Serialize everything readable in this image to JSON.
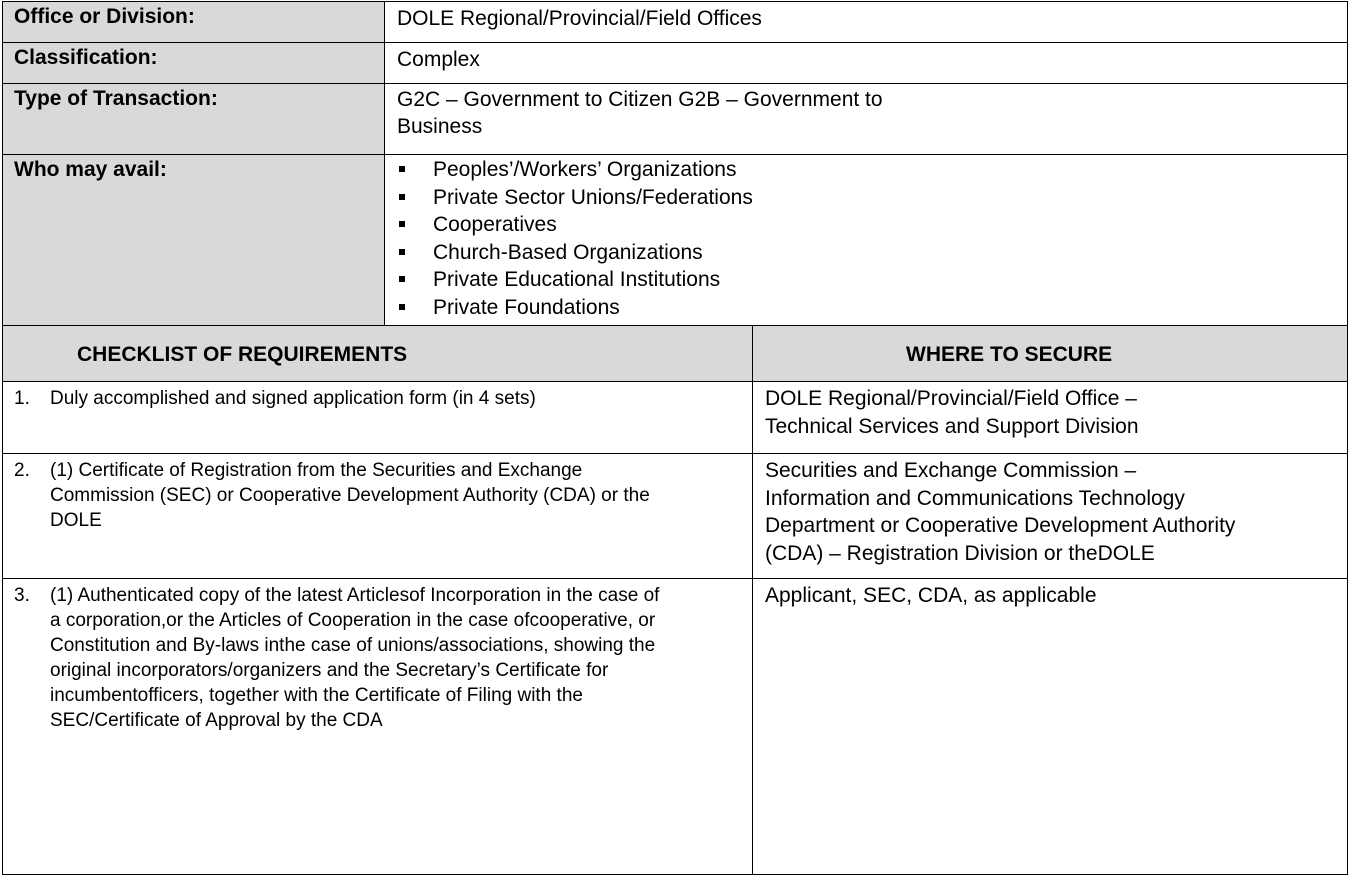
{
  "info": {
    "office_label": "Office or Division:",
    "office_value": "DOLE Regional/Provincial/Field Offices",
    "classification_label": "Classification:",
    "classification_value": "Complex",
    "transaction_label": "Type of Transaction:",
    "transaction_line1": "G2C – Government to Citizen G2B – Government to",
    "transaction_line2": "Business",
    "avail_label": "Who may avail:",
    "avail_items": [
      "Peoples’/Workers’ Organizations",
      "Private Sector Unions/Federations",
      "Cooperatives",
      "Church-Based Organizations",
      "Private Educational Institutions",
      "Private Foundations"
    ]
  },
  "checklist": {
    "header_requirements": "CHECKLIST OF REQUIREMENTS",
    "header_where": "WHERE TO SECURE",
    "rows": [
      {
        "number": "1.",
        "requirement_lines": [
          "Duly accomplished and signed application form (in 4 sets)"
        ],
        "where_lines": [
          "DOLE Regional/Provincial/Field Office –",
          "Technical Services and Support Division"
        ]
      },
      {
        "number": "2.",
        "requirement_lines": [
          "(1) Certificate of Registration from the Securities and Exchange",
          "Commission (SEC) or Cooperative Development Authority (CDA) or the",
          "DOLE"
        ],
        "where_lines": [
          "Securities and Exchange Commission –",
          "Information and Communications Technology",
          "Department or Cooperative Development Authority",
          "(CDA) – Registration Division or theDOLE"
        ]
      },
      {
        "number": "3.",
        "requirement_lines": [
          "(1) Authenticated copy of the latest Articlesof Incorporation in the case of",
          "a corporation,or the Articles of Cooperation in the case ofcooperative, or",
          "Constitution and By-laws inthe case of unions/associations, showing the",
          "original incorporators/organizers and the Secretary’s Certificate for",
          "incumbentofficers, together with the Certificate of Filing with the",
          "SEC/Certificate of Approval by the CDA"
        ],
        "where_lines": [
          "Applicant, SEC, CDA, as applicable"
        ]
      }
    ]
  }
}
